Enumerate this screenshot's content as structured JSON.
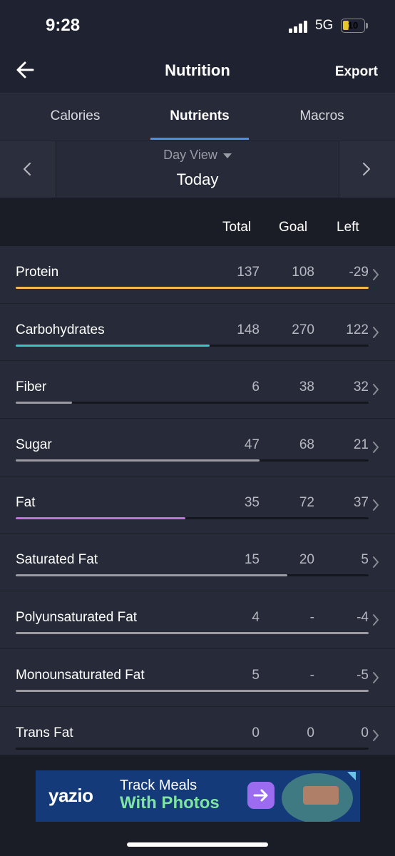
{
  "status": {
    "time": "9:28",
    "network": "5G",
    "battery": "10"
  },
  "header": {
    "title": "Nutrition",
    "export_label": "Export"
  },
  "tabs": [
    {
      "label": "Calories",
      "active": false
    },
    {
      "label": "Nutrients",
      "active": true
    },
    {
      "label": "Macros",
      "active": false
    }
  ],
  "date_nav": {
    "view_label": "Day View",
    "date_label": "Today"
  },
  "columns": {
    "total": "Total",
    "goal": "Goal",
    "left": "Left"
  },
  "nutrients": [
    {
      "name": "Protein",
      "total": "137",
      "goal": "108",
      "left": "-29",
      "progress": 1.0,
      "color": "#f2b84b"
    },
    {
      "name": "Carbohydrates",
      "total": "148",
      "goal": "270",
      "left": "122",
      "progress": 0.55,
      "color": "#3bc4c4"
    },
    {
      "name": "Fiber",
      "total": "6",
      "goal": "38",
      "left": "32",
      "progress": 0.16,
      "color": "#9a9aa0"
    },
    {
      "name": "Sugar",
      "total": "47",
      "goal": "68",
      "left": "21",
      "progress": 0.69,
      "color": "#9a9aa0"
    },
    {
      "name": "Fat",
      "total": "35",
      "goal": "72",
      "left": "37",
      "progress": 0.48,
      "color": "#c46fe0"
    },
    {
      "name": "Saturated Fat",
      "total": "15",
      "goal": "20",
      "left": "5",
      "progress": 0.77,
      "color": "#9a9aa0"
    },
    {
      "name": "Polyunsaturated Fat",
      "total": "4",
      "goal": "-",
      "left": "-4",
      "progress": 1.0,
      "color": "#9a9aa0"
    },
    {
      "name": "Monounsaturated Fat",
      "total": "5",
      "goal": "-",
      "left": "-5",
      "progress": 1.0,
      "color": "#9a9aa0"
    },
    {
      "name": "Trans Fat",
      "total": "0",
      "goal": "0",
      "left": "0",
      "progress": 0.0,
      "color": "#9a9aa0"
    }
  ],
  "ad": {
    "brand": "yazio",
    "line1": "Track Meals",
    "line2": "With Photos"
  }
}
